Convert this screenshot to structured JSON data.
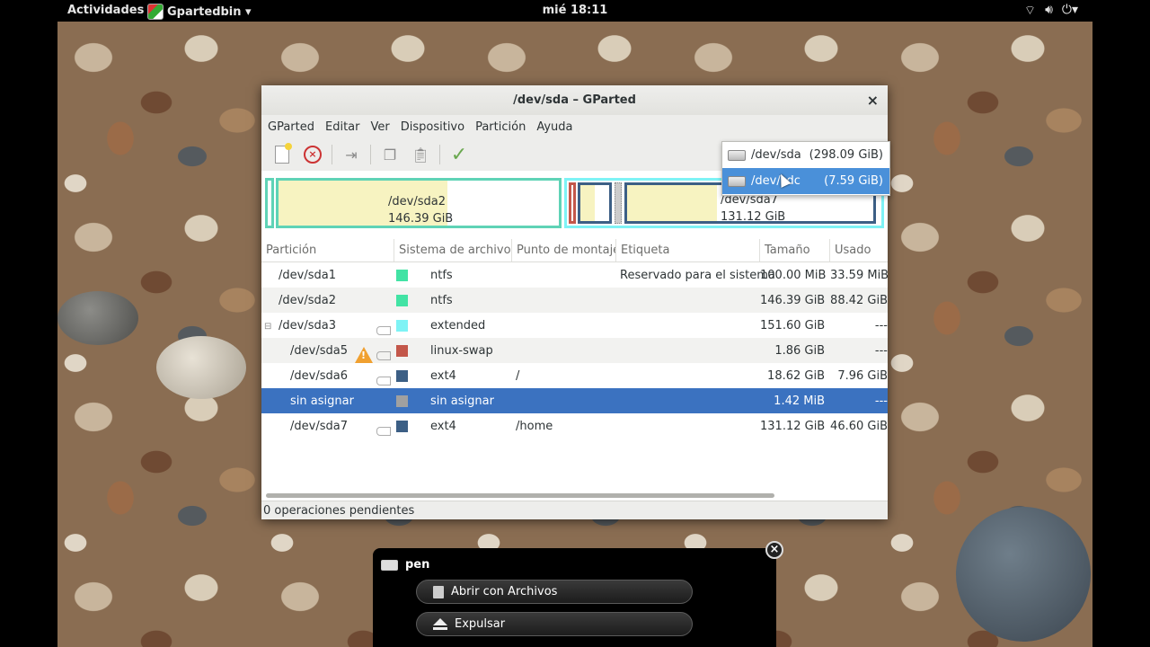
{
  "topbar": {
    "activities": "Actividades",
    "app_menu": "Gpartedbin ▾",
    "clock": "mié 18:11",
    "tray": {
      "network": "network-wireless-icon",
      "volume": "volume-icon",
      "power": "power-icon"
    }
  },
  "window": {
    "title": "/dev/sda – GParted",
    "close": "×"
  },
  "menubar": [
    "GParted",
    "Editar",
    "Ver",
    "Dispositivo",
    "Partición",
    "Ayuda"
  ],
  "device_menu": [
    {
      "name": "/dev/sda",
      "size": "(298.09 GiB)",
      "active": false
    },
    {
      "name": "/dev/sdc",
      "size": "(7.59 GiB)",
      "active": true
    }
  ],
  "partition_map": {
    "sda2": {
      "name": "/dev/sda2",
      "size": "146.39 GiB"
    },
    "sda7": {
      "name": "/dev/sda7",
      "size": "131.12 GiB"
    }
  },
  "table": {
    "headers": [
      "Partición",
      "Sistema de archivos",
      "Punto de montaje",
      "Etiqueta",
      "Tamaño",
      "Usado"
    ],
    "rows": [
      {
        "partition": "/dev/sda1",
        "fs": "ntfs",
        "color": "#42e3a4",
        "mount": "",
        "label": "Reservado para el sistema",
        "size": "100.00 MiB",
        "used": "33.59 MiB"
      },
      {
        "partition": "/dev/sda2",
        "fs": "ntfs",
        "color": "#42e3a4",
        "mount": "",
        "label": "",
        "size": "146.39 GiB",
        "used": "88.42 GiB"
      },
      {
        "partition": "/dev/sda3",
        "fs": "extended",
        "color": "#7ef3f5",
        "mount": "",
        "label": "",
        "size": "151.60 GiB",
        "used": "---"
      },
      {
        "partition": "/dev/sda5",
        "fs": "linux-swap",
        "color": "#c3574a",
        "mount": "",
        "label": "",
        "size": "1.86 GiB",
        "used": "---"
      },
      {
        "partition": "/dev/sda6",
        "fs": "ext4",
        "color": "#3c5f85",
        "mount": "/",
        "label": "",
        "size": "18.62 GiB",
        "used": "7.96 GiB"
      },
      {
        "partition": "sin asignar",
        "fs": "sin asignar",
        "color": "#a0a0a0",
        "mount": "",
        "label": "",
        "size": "1.42 MiB",
        "used": "---"
      },
      {
        "partition": "/dev/sda7",
        "fs": "ext4",
        "color": "#3c5f85",
        "mount": "/home",
        "label": "",
        "size": "131.12 GiB",
        "used": "46.60 GiB"
      }
    ]
  },
  "status": "0 operaciones pendientes",
  "notification": {
    "title": "pen",
    "open_button": "Abrir con Archivos",
    "eject_button": "Expulsar",
    "close": "×"
  },
  "colors": {
    "selection": "#3b72c0",
    "ntfs": "#42e3a4",
    "extended": "#7ef3f5",
    "swap": "#c3574a",
    "ext4": "#3c5f85"
  }
}
